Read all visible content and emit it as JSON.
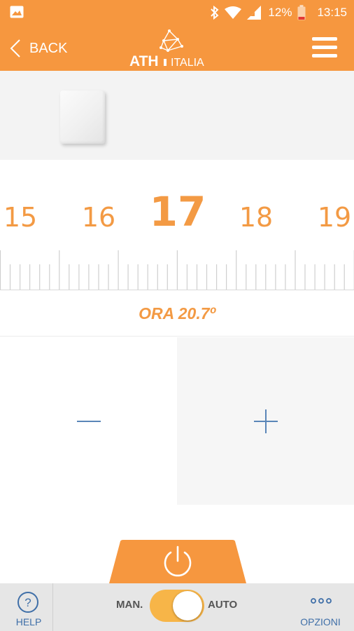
{
  "status_bar": {
    "battery_percent": "12%",
    "time": "13:15"
  },
  "app_bar": {
    "back_label": "BACK",
    "logo_text_left": "ATH",
    "logo_text_right": "ITALIA"
  },
  "thermostat": {
    "scale_values": [
      "15",
      "16",
      "17",
      "18",
      "19"
    ],
    "selected_setpoint": "17",
    "current_temperature": "ORA 20.7º"
  },
  "controls": {
    "decrease_symbol": "minus-icon",
    "increase_symbol": "plus-icon",
    "power_icon": "power-icon"
  },
  "bottom_bar": {
    "help_label": "HELP",
    "mode_manual_label": "MAN.",
    "mode_auto_label": "AUTO",
    "mode_state": "AUTO",
    "options_label": "OPZIONI"
  },
  "colors": {
    "accent": "#f6973f",
    "temperature_text": "#f39a44",
    "toggle_on": "#f7b548",
    "link_blue": "#3f6fa8"
  }
}
